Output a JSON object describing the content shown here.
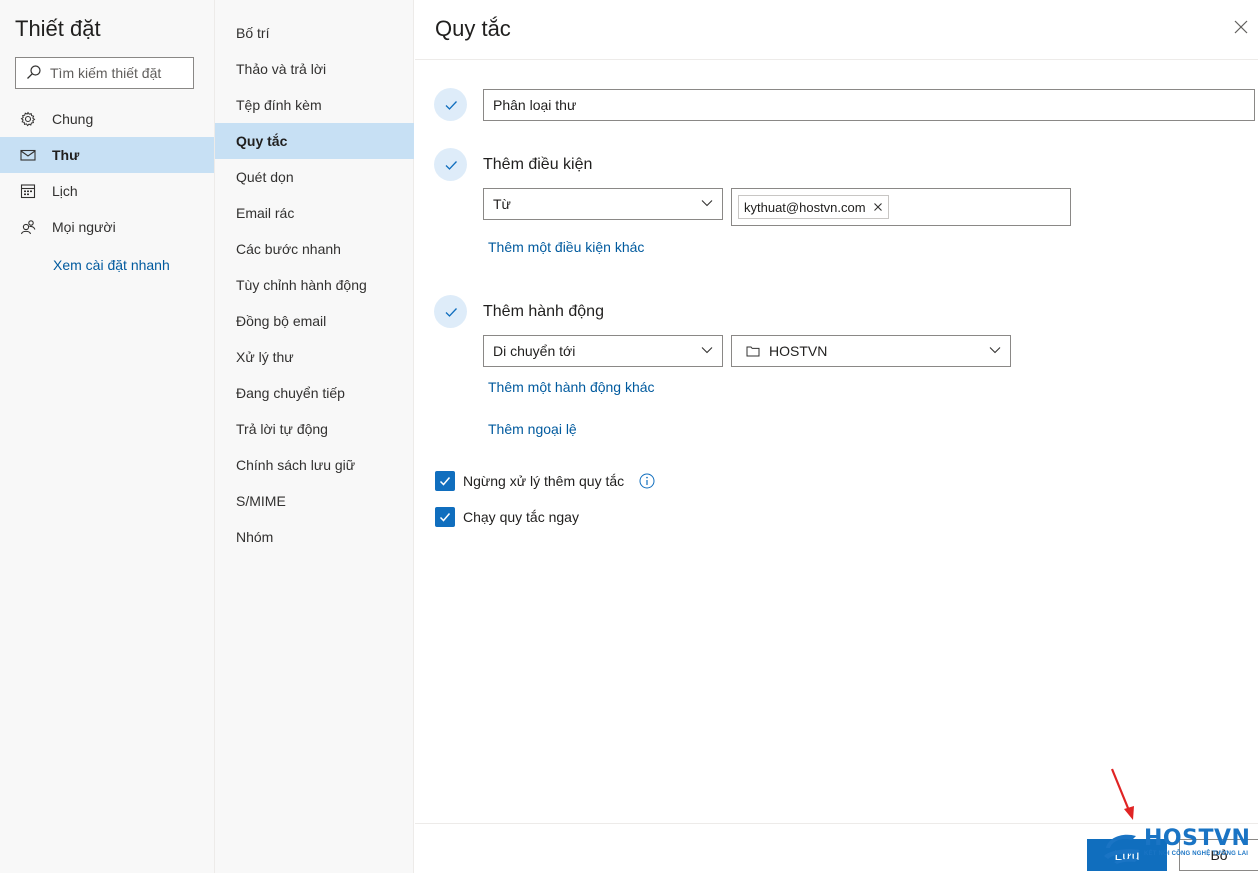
{
  "left": {
    "title": "Thiết đặt",
    "search_placeholder": "Tìm kiếm thiết đặt",
    "items": [
      {
        "label": "Chung",
        "icon": "gear-icon"
      },
      {
        "label": "Thư",
        "icon": "mail-icon"
      },
      {
        "label": "Lịch",
        "icon": "calendar-icon"
      },
      {
        "label": "Mọi người",
        "icon": "people-icon"
      }
    ],
    "quick_settings_link": "Xem cài đặt nhanh"
  },
  "middle": {
    "items": [
      "Bố trí",
      "Thảo và trả lời",
      "Tệp đính kèm",
      "Quy tắc",
      "Quét dọn",
      "Email rác",
      "Các bước nhanh",
      "Tùy chỉnh hành động",
      "Đồng bộ email",
      "Xử lý thư",
      "Đang chuyển tiếp",
      "Trả lời tự động",
      "Chính sách lưu giữ",
      "S/MIME",
      "Nhóm"
    ],
    "active_index": 3
  },
  "panel": {
    "title": "Quy tắc",
    "rule_name": "Phân loại thư",
    "condition_heading": "Thêm điều kiện",
    "condition_field": "Từ",
    "condition_chip": "kythuat@hostvn.com",
    "add_condition_link": "Thêm một điều kiện khác",
    "action_heading": "Thêm hành động",
    "action_field": "Di chuyển tới",
    "action_folder": "HOSTVN",
    "add_action_link": "Thêm một hành động khác",
    "add_exception_link": "Thêm ngoại lệ",
    "stop_processing_label": "Ngừng xử lý thêm quy tắc",
    "run_now_label": "Chạy quy tắc ngay",
    "save_label": "Lưu",
    "discard_label": "Bỏ"
  },
  "watermark": {
    "brand": "HOSTVN",
    "tagline": "KẾT NỐI CÔNG NGHỆ TƯƠNG LAI"
  },
  "colors": {
    "accent": "#106ebe",
    "selected_bg": "#c7e0f4",
    "link": "#005a9e",
    "arrow": "#e02424"
  }
}
